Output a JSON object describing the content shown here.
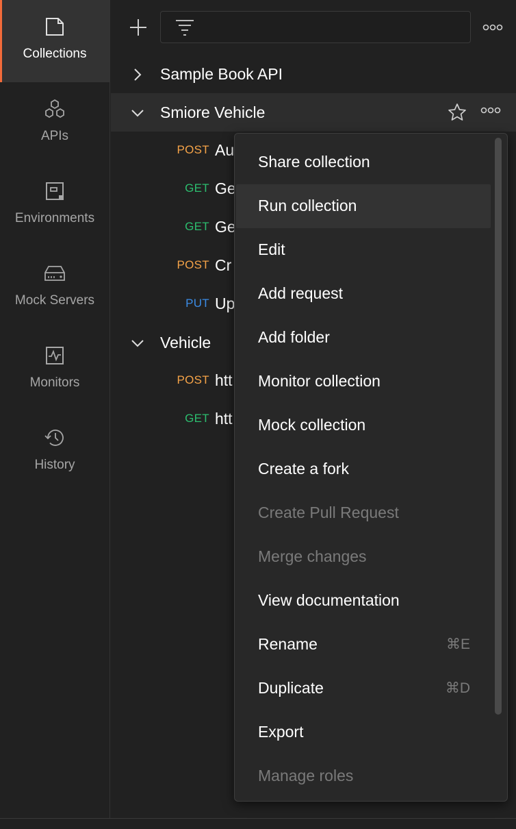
{
  "sidebar": {
    "items": [
      {
        "label": "Collections",
        "icon": "collections-icon",
        "active": true
      },
      {
        "label": "APIs",
        "icon": "apis-icon"
      },
      {
        "label": "Environments",
        "icon": "environments-icon"
      },
      {
        "label": "Mock Servers",
        "icon": "mock-servers-icon"
      },
      {
        "label": "Monitors",
        "icon": "monitors-icon"
      },
      {
        "label": "History",
        "icon": "history-icon"
      }
    ]
  },
  "toolbar": {
    "new_icon": "plus-icon",
    "filter_icon": "filter-icon",
    "filter_placeholder": "",
    "more_icon": "more-horizontal-icon"
  },
  "tree": {
    "collections": [
      {
        "name": "Sample Book API",
        "expanded": false
      },
      {
        "name": "Smiore Vehicle",
        "expanded": true
      },
      {
        "name": "Vehicle",
        "expanded": true
      }
    ],
    "requests": [
      {
        "method": "POST",
        "name": "Au"
      },
      {
        "method": "GET",
        "name": "Ge"
      },
      {
        "method": "GET",
        "name": "Ge"
      },
      {
        "method": "POST",
        "name": "Cr"
      },
      {
        "method": "PUT",
        "name": "Up"
      },
      {
        "method": "POST",
        "name": "htt"
      },
      {
        "method": "GET",
        "name": "htt"
      }
    ]
  },
  "context_menu": {
    "items": [
      {
        "label": "Share collection",
        "enabled": true
      },
      {
        "label": "Run collection",
        "enabled": true,
        "hovered": true
      },
      {
        "label": "Edit",
        "enabled": true
      },
      {
        "label": "Add request",
        "enabled": true
      },
      {
        "label": "Add folder",
        "enabled": true
      },
      {
        "label": "Monitor collection",
        "enabled": true
      },
      {
        "label": "Mock collection",
        "enabled": true
      },
      {
        "label": "Create a fork",
        "enabled": true
      },
      {
        "label": "Create Pull Request",
        "enabled": false
      },
      {
        "label": "Merge changes",
        "enabled": false
      },
      {
        "label": "View documentation",
        "enabled": true
      },
      {
        "label": "Rename",
        "enabled": true,
        "shortcut": "⌘E"
      },
      {
        "label": "Duplicate",
        "enabled": true,
        "shortcut": "⌘D"
      },
      {
        "label": "Export",
        "enabled": true
      },
      {
        "label": "Manage roles",
        "enabled": false
      }
    ]
  },
  "colors": {
    "accent": "#f26b3a",
    "post": "#f5a348",
    "get": "#2cbe6f",
    "put": "#3b8ce6",
    "background": "#212121",
    "menu_background": "#282828"
  }
}
